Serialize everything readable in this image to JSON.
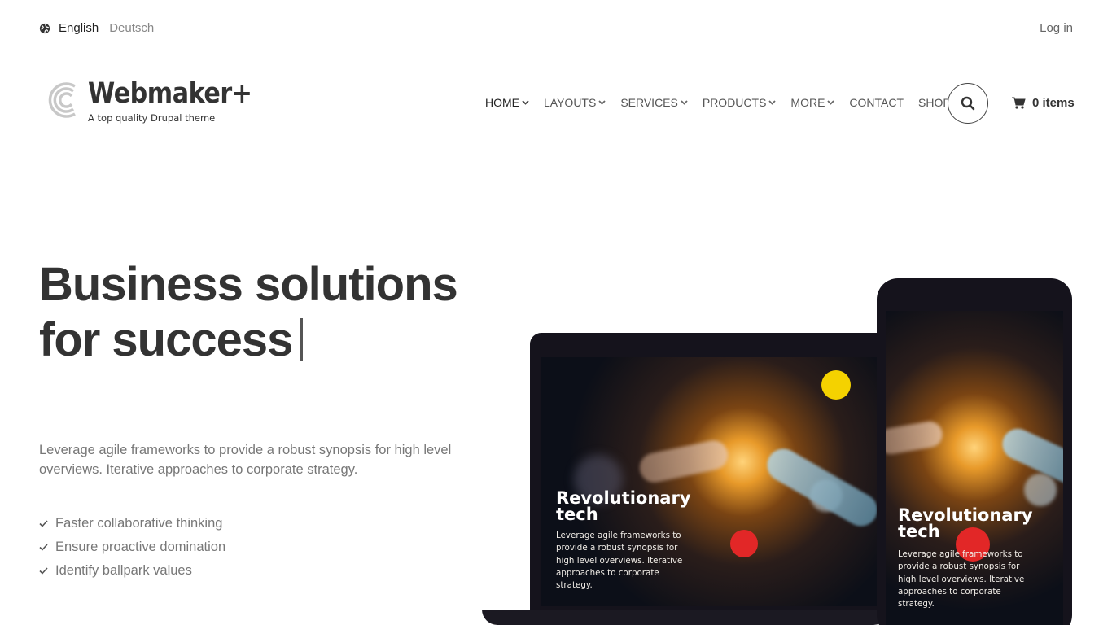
{
  "topbar": {
    "languages": [
      {
        "label": "English",
        "active": true
      },
      {
        "label": "Deutsch",
        "active": false
      }
    ],
    "login_label": "Log in"
  },
  "branding": {
    "site_name": "Webmaker+",
    "slogan": "A top quality Drupal theme"
  },
  "nav": {
    "items": [
      {
        "label": "HOME",
        "has_dropdown": true,
        "active": true
      },
      {
        "label": "LAYOUTS",
        "has_dropdown": true
      },
      {
        "label": "SERVICES",
        "has_dropdown": true
      },
      {
        "label": "PRODUCTS",
        "has_dropdown": true
      },
      {
        "label": "MORE",
        "has_dropdown": true
      },
      {
        "label": "CONTACT",
        "has_dropdown": false
      },
      {
        "label": "SHOP",
        "has_dropdown": false
      }
    ],
    "search_icon": "search-icon",
    "cart_label": "0 items"
  },
  "hero": {
    "title_line1": "Business solutions",
    "title_line2": "for success",
    "text": "Leverage agile frameworks to provide a robust synopsis for high level overviews. Iterative approaches to corporate strategy.",
    "checklist": [
      "Faster collaborative thinking",
      "Ensure proactive domination",
      "Identify ballpark values"
    ]
  },
  "devices": {
    "laptop": {
      "title_line1": "Revolutionary",
      "title_line2": "tech",
      "text_lines": [
        "Leverage agile frameworks to",
        "provide a robust synopsis for",
        "high level overviews. Iterative",
        "approaches to corporate",
        "strategy."
      ]
    },
    "phone": {
      "title_line1": "Revolutionary",
      "title_line2": "tech",
      "text_lines": [
        "Leverage agile frameworks to",
        "provide a robust synopsis for",
        "high level overviews. Iterative",
        "approaches to corporate",
        "strategy."
      ]
    }
  },
  "colors": {
    "text_dark": "#333333",
    "text_muted": "#777777",
    "device_frame": "#15131c",
    "divider": "#cfcfcf"
  }
}
